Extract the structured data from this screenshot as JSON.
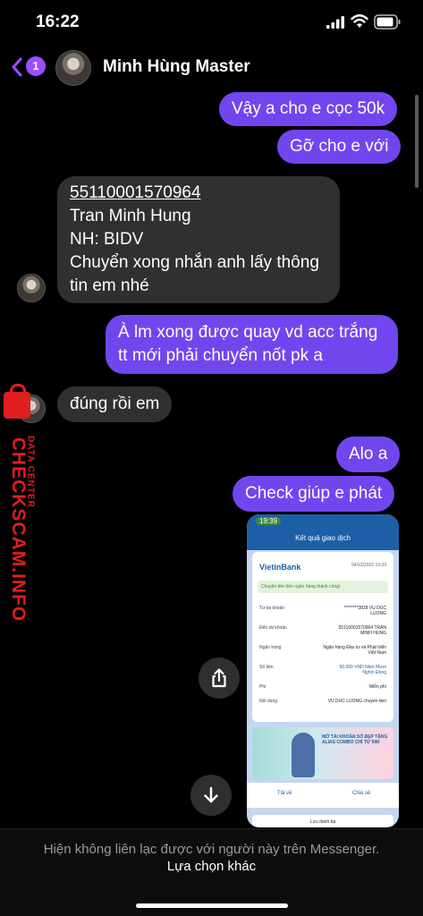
{
  "status_bar": {
    "time": "16:22"
  },
  "header": {
    "unread_count": "1",
    "contact_name": "Minh Hùng Master"
  },
  "messages": {
    "m1": "Vậy a cho e cọc 50k",
    "m2": "Gỡ cho e với",
    "m3_lines": [
      "55110001570964",
      "Tran Minh Hung",
      "NH: BIDV",
      "Chuyển xong nhắn anh lấy thông",
      "tin em nhé"
    ],
    "m4_lines": [
      "À lm xong được quay vd acc trắng",
      "tt mới phải chuyển nốt pk a"
    ],
    "m5": "đúng rồi em",
    "m6": "Alo a",
    "m7": "Check giúp e phát"
  },
  "attachment": {
    "status_time": "19:39",
    "title": "Kết quả giao dịch",
    "bank": "VietinBank",
    "date": "04/12/2022 19:39",
    "success": "Chuyển tiền liên ngân hàng thành công!",
    "rows": [
      {
        "key": "Từ tài khoản",
        "value": "********3828 VU DUC LUONG"
      },
      {
        "key": "Đến tài khoản",
        "value": "55110001570964 TRAN MINH HUNG"
      },
      {
        "key": "Ngân hàng",
        "value": "Ngân hàng Đầu tư và Phát triển Việt Nam"
      },
      {
        "key": "Số tiền",
        "value": "50,000 VND Năm Mươi Nghìn Đồng"
      },
      {
        "key": "Phí",
        "value": "Miễn phí"
      },
      {
        "key": "Nội dung",
        "value": "VU DUC LUONG chuyen tien"
      }
    ],
    "promo": "MỞ TÀI KHOẢN SỐ ĐẸP TẶNG ALIAS COMBO CHỈ TỪ 99K",
    "save_label": "Tải về",
    "share_label": "Chia sẻ",
    "bottom_button": "Lưu danh bạ"
  },
  "watermark": {
    "small": "DATA CENTER",
    "big": "CHECKSCAM.INFO"
  },
  "footer": {
    "note": "Hiện không liên lạc được với người này trên Messenger.",
    "option": "Lựa chọn khác"
  },
  "colors": {
    "outgoing": "#7246ee",
    "incoming": "#303030",
    "accent": "#9b4dff",
    "watermark": "#e01e1e"
  }
}
